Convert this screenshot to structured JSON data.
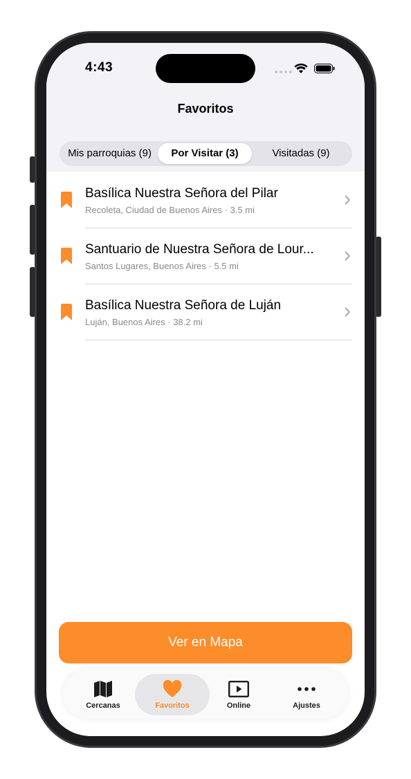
{
  "status_bar": {
    "time": "4:43"
  },
  "nav": {
    "title": "Favoritos"
  },
  "segments": [
    {
      "label": "Mis parroquias (9)",
      "selected": false
    },
    {
      "label": "Por Visitar (3)",
      "selected": true
    },
    {
      "label": "Visitadas (9)",
      "selected": false
    }
  ],
  "places": [
    {
      "name": "Basílica Nuestra Señora del Pilar",
      "subtitle": "Recoleta, Ciudad de Buenos Aires · 3.5 mi",
      "icon": "bookmark-icon"
    },
    {
      "name": "Santuario de Nuestra Señora de Lour...",
      "subtitle": "Santos Lugares, Buenos Aires · 5.5 mi",
      "icon": "bookmark-icon"
    },
    {
      "name": "Basílica Nuestra Señora de Luján",
      "subtitle": "Luján, Buenos Aires · 38.2 mi",
      "icon": "bookmark-icon"
    }
  ],
  "actions": {
    "map_button": "Ver en Mapa"
  },
  "tabs": [
    {
      "label": "Cercanas",
      "icon": "map-icon",
      "selected": false
    },
    {
      "label": "Favoritos",
      "icon": "heart-icon",
      "selected": true
    },
    {
      "label": "Online",
      "icon": "play-icon",
      "selected": false
    },
    {
      "label": "Ajustes",
      "icon": "ellipsis-icon",
      "selected": false
    }
  ],
  "colors": {
    "accent": "#fd8c2a",
    "background": "#f2f2f7",
    "secondary_text": "#8a8a8e"
  }
}
